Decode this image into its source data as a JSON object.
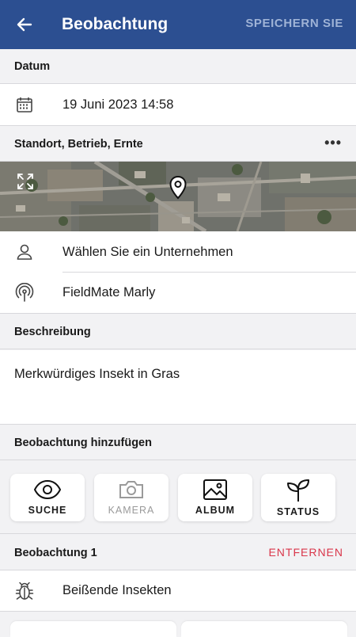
{
  "appbar": {
    "title": "Beobachtung",
    "save_label": "SPEICHERN SIE",
    "back_icon": "arrow-left-icon",
    "color": "#2c4f91"
  },
  "date_section": {
    "header": "Datum",
    "value": "19 Juni 2023 14:58",
    "icon": "calendar-icon"
  },
  "location_section": {
    "header": "Standort, Betrieb, Ernte",
    "more_icon": "more-horizontal-icon",
    "map_expand_icon": "expand-icon",
    "map_pin_icon": "map-pin-icon",
    "company_placeholder": "Wählen Sie ein Unternehmen",
    "company_icon": "person-icon",
    "device_value": "FieldMate Marly",
    "device_icon": "antenna-icon"
  },
  "description_section": {
    "header": "Beschreibung",
    "value": "Merkwürdiges Insekt in Gras"
  },
  "add_section": {
    "header": "Beobachtung hinzufügen",
    "buttons": [
      {
        "label": "SUCHE",
        "icon": "eye-icon",
        "enabled": true
      },
      {
        "label": "KAMERA",
        "icon": "camera-icon",
        "enabled": false
      },
      {
        "label": "ALBUM",
        "icon": "image-icon",
        "enabled": true
      },
      {
        "label": "STATUS",
        "icon": "sprout-icon",
        "enabled": true
      }
    ]
  },
  "observation": {
    "header": "Beobachtung 1",
    "remove_label": "ENTFERNEN",
    "value": "Beißende Insekten",
    "icon": "bug-icon",
    "remove_color": "#d9364a"
  }
}
